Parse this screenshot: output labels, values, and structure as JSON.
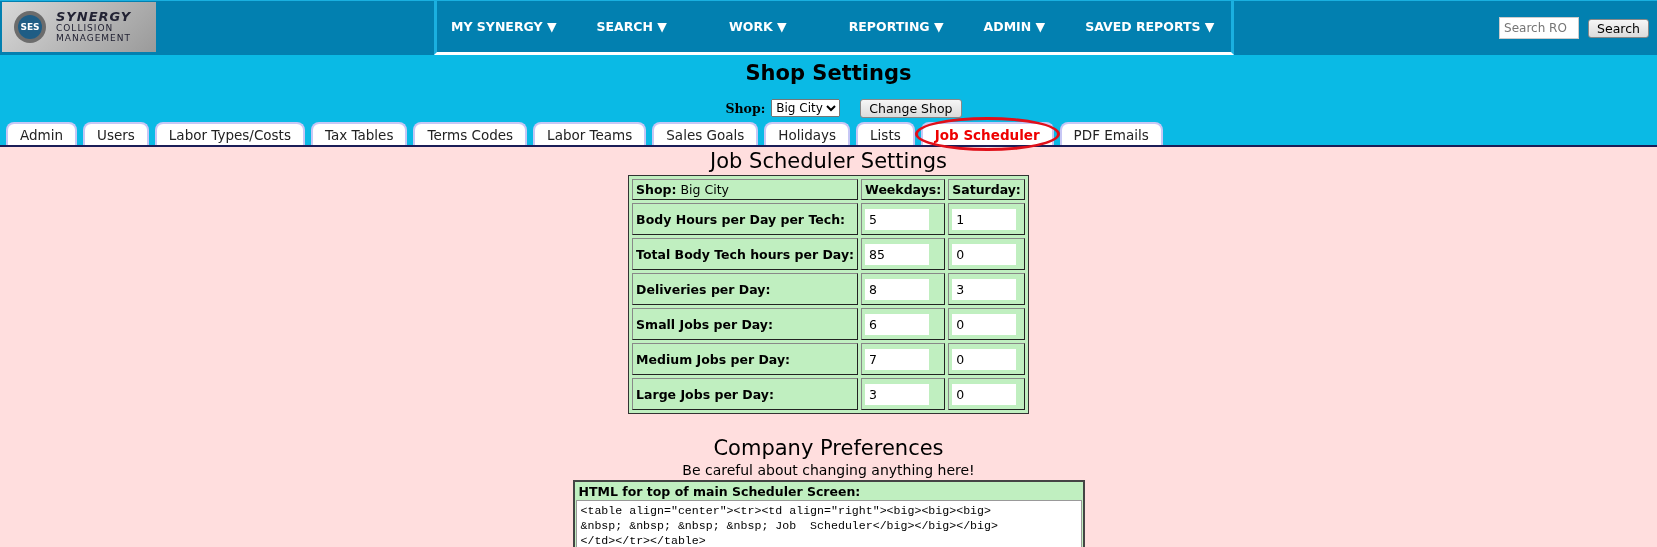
{
  "logo": {
    "badge": "SES",
    "line_1": "SYNERGY",
    "line_2": "COLLISION",
    "line_3": "MANAGEMENT"
  },
  "nav": [
    {
      "label": "MY SYNERGY ▼"
    },
    {
      "label": "SEARCH ▼"
    },
    {
      "label": "WORK ▼"
    },
    {
      "label": "REPORTING ▼"
    },
    {
      "label": "ADMIN ▼"
    },
    {
      "label": "SAVED REPORTS ▼"
    }
  ],
  "search": {
    "placeholder": "Search RO",
    "button": "Search"
  },
  "page_title": "Shop Settings",
  "shop_picker": {
    "label": "Shop:",
    "value": "Big City",
    "button": "Change Shop"
  },
  "tabs": [
    {
      "label": "Admin",
      "selected": false
    },
    {
      "label": "Users",
      "selected": false
    },
    {
      "label": "Labor Types/Costs",
      "selected": false
    },
    {
      "label": "Tax Tables",
      "selected": false
    },
    {
      "label": "Terms Codes",
      "selected": false
    },
    {
      "label": "Labor Teams",
      "selected": false
    },
    {
      "label": "Sales Goals",
      "selected": false
    },
    {
      "label": "Holidays",
      "selected": false
    },
    {
      "label": "Lists",
      "selected": false
    },
    {
      "label": "Job Scheduler",
      "selected": true,
      "circled": true
    },
    {
      "label": "PDF Emails",
      "selected": false
    }
  ],
  "scheduler": {
    "title": "Job Scheduler Settings",
    "shop_label": "Shop:",
    "shop_value": "Big City",
    "columns": [
      "Weekdays:",
      "Saturday:"
    ],
    "rows": [
      {
        "label": "Body Hours per Day per Tech:",
        "weekdays": "5",
        "saturday": "1"
      },
      {
        "label": "Total Body Tech hours per Day:",
        "weekdays": "85",
        "saturday": "0"
      },
      {
        "label": "Deliveries per Day:",
        "weekdays": "8",
        "saturday": "3"
      },
      {
        "label": "Small Jobs per Day:",
        "weekdays": "6",
        "saturday": "0"
      },
      {
        "label": "Medium Jobs per Day:",
        "weekdays": "7",
        "saturday": "0"
      },
      {
        "label": "Large Jobs per Day:",
        "weekdays": "3",
        "saturday": "0"
      }
    ]
  },
  "preferences": {
    "title": "Company Preferences",
    "warning": "Be careful about changing anything here!",
    "field_label": "HTML for top of main Scheduler Screen:",
    "field_value": "<table align=\"center\"><tr><td align=\"right\"><big><big><big>\n&nbsp; &nbsp; &nbsp; &nbsp; Job  Scheduler</big></big></big>\n</td></tr></table>"
  }
}
